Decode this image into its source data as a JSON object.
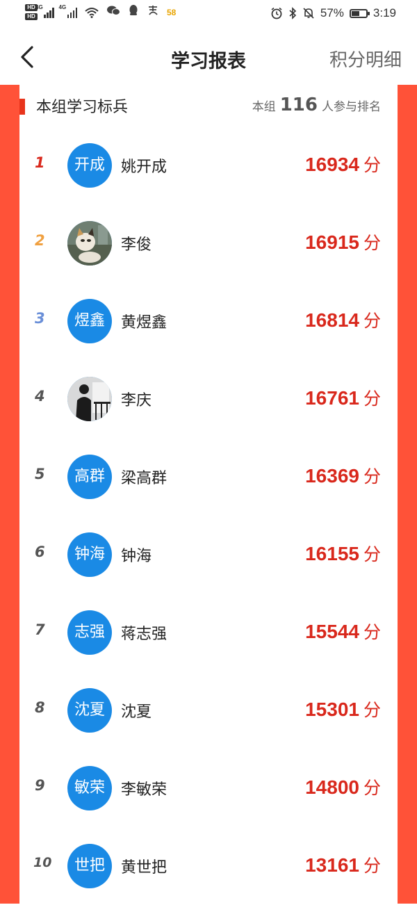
{
  "status_bar": {
    "hd1": "HD",
    "hd2": "HD",
    "net1": "4G",
    "net2": "4G",
    "badge": "58",
    "battery_pct": "57%",
    "time": "3:19",
    "battery_level": 0.57
  },
  "header": {
    "title": "学习报表",
    "right_link": "积分明细"
  },
  "section": {
    "title": "本组学习标兵",
    "count_prefix": "本组",
    "count": "116",
    "count_suffix": "人参与排名"
  },
  "colors": {
    "accent_red": "#ff5238",
    "score_red": "#d9281c",
    "avatar_blue": "#1a8ae5",
    "rank1": "#d9281c",
    "rank2": "#f0a040",
    "rank3": "#6a8fd8"
  },
  "ranking": [
    {
      "rank": "1",
      "avatar_text": "开成",
      "name": "姚开成",
      "score": "16934",
      "unit": "分"
    },
    {
      "rank": "2",
      "avatar_text": "",
      "avatar_icon": "cat-photo",
      "name": "李俊",
      "score": "16915",
      "unit": "分"
    },
    {
      "rank": "3",
      "avatar_text": "煜鑫",
      "name": "黄煜鑫",
      "score": "16814",
      "unit": "分"
    },
    {
      "rank": "4",
      "avatar_text": "",
      "avatar_icon": "person-photo",
      "name": "李庆",
      "score": "16761",
      "unit": "分"
    },
    {
      "rank": "5",
      "avatar_text": "高群",
      "name": "梁高群",
      "score": "16369",
      "unit": "分"
    },
    {
      "rank": "6",
      "avatar_text": "钟海",
      "name": "钟海",
      "score": "16155",
      "unit": "分"
    },
    {
      "rank": "7",
      "avatar_text": "志强",
      "name": "蒋志强",
      "score": "15544",
      "unit": "分"
    },
    {
      "rank": "8",
      "avatar_text": "沈夏",
      "name": "沈夏",
      "score": "15301",
      "unit": "分"
    },
    {
      "rank": "9",
      "avatar_text": "敏荣",
      "name": "李敏荣",
      "score": "14800",
      "unit": "分"
    },
    {
      "rank": "10",
      "avatar_text": "世把",
      "name": "黄世把",
      "score": "13161",
      "unit": "分"
    }
  ]
}
